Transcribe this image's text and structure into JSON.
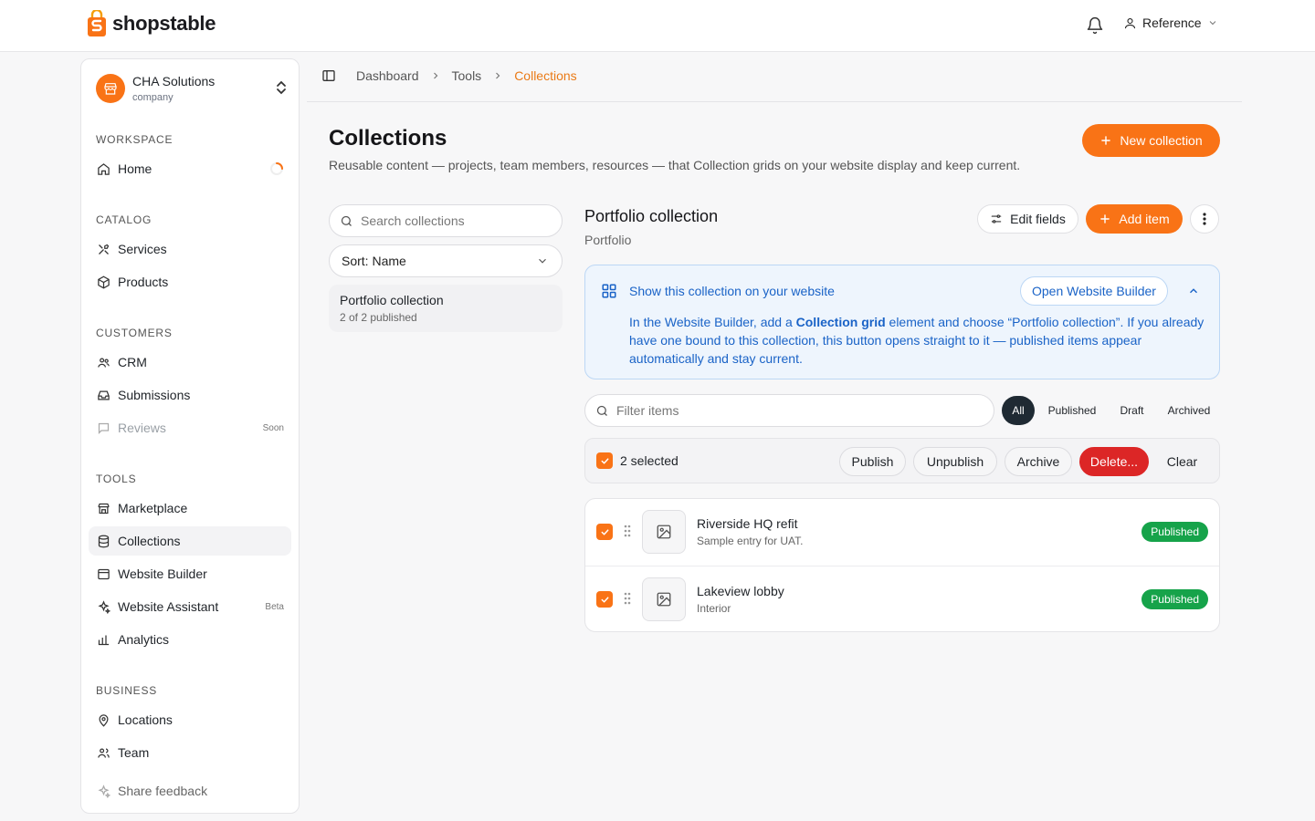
{
  "brand": {
    "name": "shopstable",
    "accent": "#f97316"
  },
  "header": {
    "user_label": "Reference",
    "icons": [
      "bell-icon",
      "user-icon",
      "chevron-down-icon"
    ]
  },
  "sidebar": {
    "company": {
      "name": "CHA Solutions",
      "type": "company"
    },
    "sections": [
      {
        "label": "WORKSPACE",
        "items": [
          {
            "label": "Home",
            "icon": "home-icon"
          }
        ]
      },
      {
        "label": "CATALOG",
        "items": [
          {
            "label": "Services",
            "icon": "tools-icon"
          },
          {
            "label": "Products",
            "icon": "box-icon"
          }
        ]
      },
      {
        "label": "CUSTOMERS",
        "items": [
          {
            "label": "CRM",
            "icon": "users-icon"
          },
          {
            "label": "Submissions",
            "icon": "inbox-icon"
          },
          {
            "label": "Reviews",
            "icon": "message-icon",
            "badge": "Soon"
          }
        ]
      },
      {
        "label": "TOOLS",
        "items": [
          {
            "label": "Marketplace",
            "icon": "store-icon"
          },
          {
            "label": "Collections",
            "icon": "database-icon"
          },
          {
            "label": "Website Builder",
            "icon": "browser-icon"
          },
          {
            "label": "Website Assistant",
            "icon": "sparkle-icon",
            "badge": "Beta"
          },
          {
            "label": "Analytics",
            "icon": "chart-icon"
          }
        ]
      },
      {
        "label": "BUSINESS",
        "items": [
          {
            "label": "Locations",
            "icon": "pin-icon"
          },
          {
            "label": "Team",
            "icon": "team-icon"
          }
        ]
      }
    ],
    "feedback": "Share feedback"
  },
  "breadcrumb": [
    "Dashboard",
    "Tools",
    "Collections"
  ],
  "page": {
    "title": "Collections",
    "subtitle": "Reusable content — projects, team members, resources — that Collection grids on your website display and keep current.",
    "new_button": "New collection"
  },
  "collections_panel": {
    "search_placeholder": "Search collections",
    "sort_label": "Sort: Name",
    "items": [
      {
        "name": "Portfolio collection",
        "meta": "2 of 2 published"
      }
    ]
  },
  "detail": {
    "title": "Portfolio collection",
    "subtitle": "Portfolio",
    "edit_fields": "Edit fields",
    "add_item": "Add item",
    "info": {
      "heading": "Show this collection on your website",
      "button": "Open Website Builder",
      "body_prefix": "In the Website Builder, add a ",
      "body_bold": "Collection grid",
      "body_suffix": " element and choose “Portfolio collection”. If you already have one bound to this collection, this button opens straight to it — published items appear automatically and stay current."
    },
    "filter_placeholder": "Filter items",
    "tabs": [
      "All",
      "Published",
      "Draft",
      "Archived"
    ],
    "active_tab": "All",
    "bulk": {
      "count": "2 selected",
      "publish": "Publish",
      "unpublish": "Unpublish",
      "archive": "Archive",
      "delete": "Delete...",
      "clear": "Clear"
    },
    "items": [
      {
        "title": "Riverside HQ refit",
        "desc": "Sample entry for UAT.",
        "status": "Published",
        "selected": true
      },
      {
        "title": "Lakeview lobby",
        "desc": "Interior",
        "status": "Published",
        "selected": true
      }
    ]
  }
}
